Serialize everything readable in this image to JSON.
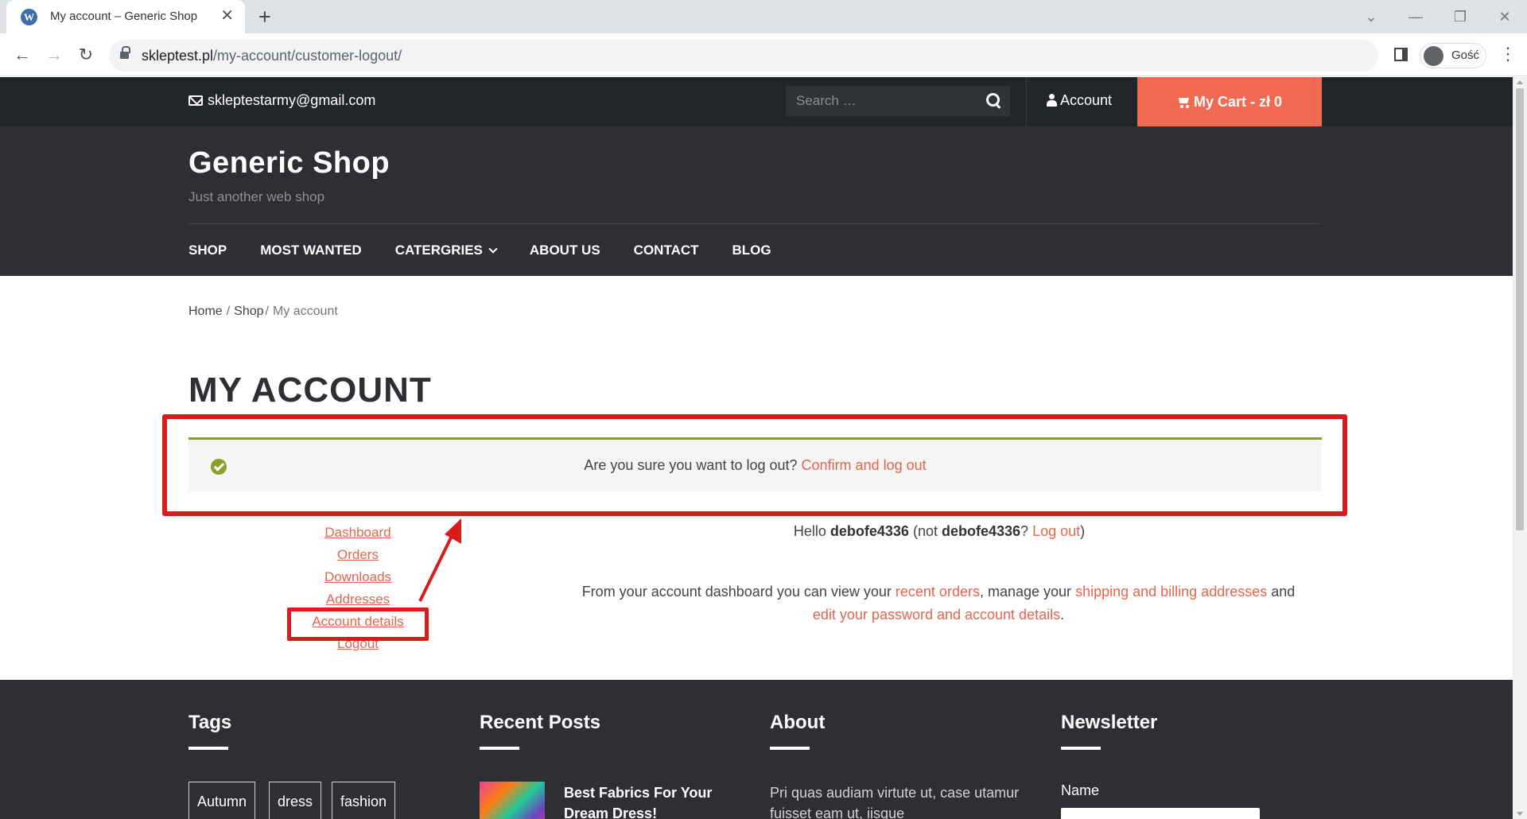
{
  "browser": {
    "tab_title": "My account – Generic Shop",
    "url_host": "skleptest.pl",
    "url_path": "/my-account/customer-logout/",
    "profile_label": "Gość"
  },
  "topbar": {
    "email": "skleptestarmy@gmail.com",
    "search_placeholder": "Search …",
    "account_label": "Account",
    "cart_label": "My Cart - zł 0"
  },
  "header": {
    "site_title": "Generic Shop",
    "tagline": "Just another web shop",
    "nav": [
      "SHOP",
      "MOST WANTED",
      "CATERGRIES",
      "ABOUT US",
      "CONTACT",
      "BLOG"
    ]
  },
  "breadcrumb": {
    "home": "Home",
    "shop": "Shop",
    "current": "My account"
  },
  "page_title": "MY ACCOUNT",
  "notice": {
    "question": "Are you sure you want to log out?",
    "confirm_link": "Confirm and log out"
  },
  "account_nav": [
    "Dashboard",
    "Orders",
    "Downloads",
    "Addresses",
    "Account details",
    "Logout"
  ],
  "dashboard": {
    "hello_prefix": "Hello",
    "username": "debofe4336",
    "not_prefix": "(not",
    "username_again": "debofe4336",
    "q_mark": "?",
    "logout_link": "Log out",
    "close_paren": ")",
    "text_1": "From your account dashboard you can view your",
    "link_orders": "recent orders",
    "text_2": ", manage your",
    "link_addresses": "shipping and billing addresses",
    "text_3": "and",
    "link_account": "edit your password and account details",
    "text_4": "."
  },
  "footer": {
    "tags_title": "Tags",
    "tags": [
      "Autumn",
      "dress",
      "fashion"
    ],
    "recent_title": "Recent Posts",
    "recent_post": "Best Fabrics For Your Dream Dress!",
    "about_title": "About",
    "about_text": "Pri quas audiam virtute ut, case utamur fuisset eam ut, iisque",
    "newsletter_title": "Newsletter",
    "name_label": "Name"
  },
  "annotation_colors": {
    "highlight": "#d81b1b",
    "accent": "#f26a52"
  }
}
